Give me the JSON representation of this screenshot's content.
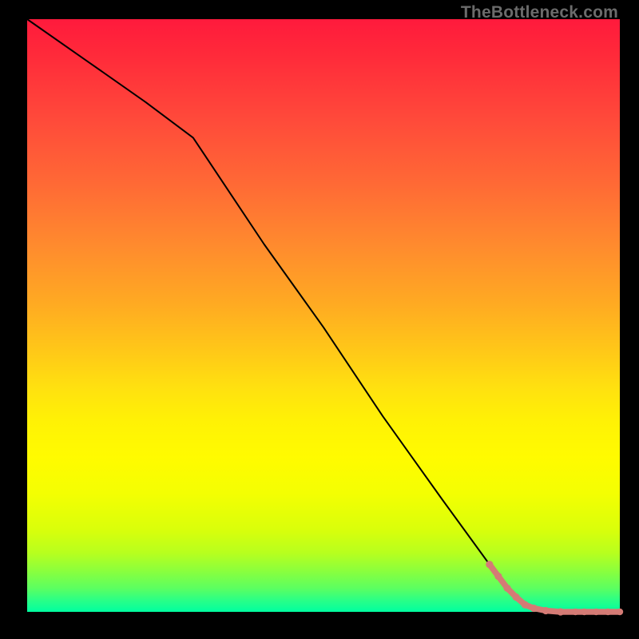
{
  "watermark": "TheBottleneck.com",
  "chart_data": {
    "type": "line",
    "title": "",
    "xlabel": "",
    "ylabel": "",
    "xlim": [
      0,
      100
    ],
    "ylim": [
      0,
      100
    ],
    "grid": false,
    "legend": false,
    "series": [
      {
        "name": "curve",
        "x": [
          0,
          10,
          20,
          28,
          40,
          50,
          60,
          70,
          78,
          82,
          85,
          90,
          95,
          100
        ],
        "y": [
          100,
          93,
          86,
          80,
          62,
          48,
          33,
          19,
          8,
          3,
          1,
          0,
          0,
          0
        ]
      }
    ],
    "markers": {
      "name": "highlight",
      "color": "#d47b75",
      "points": [
        {
          "x": 78.0,
          "y": 8.0
        },
        {
          "x": 79.5,
          "y": 6.0
        },
        {
          "x": 81.0,
          "y": 4.0
        },
        {
          "x": 82.5,
          "y": 2.5
        },
        {
          "x": 84.0,
          "y": 1.2
        },
        {
          "x": 85.5,
          "y": 0.6
        },
        {
          "x": 87.5,
          "y": 0.2
        },
        {
          "x": 90.0,
          "y": 0.0
        },
        {
          "x": 92.5,
          "y": 0.0
        },
        {
          "x": 94.0,
          "y": 0.0
        },
        {
          "x": 96.0,
          "y": 0.0
        },
        {
          "x": 98.0,
          "y": 0.0
        },
        {
          "x": 100.0,
          "y": 0.0
        }
      ]
    }
  }
}
